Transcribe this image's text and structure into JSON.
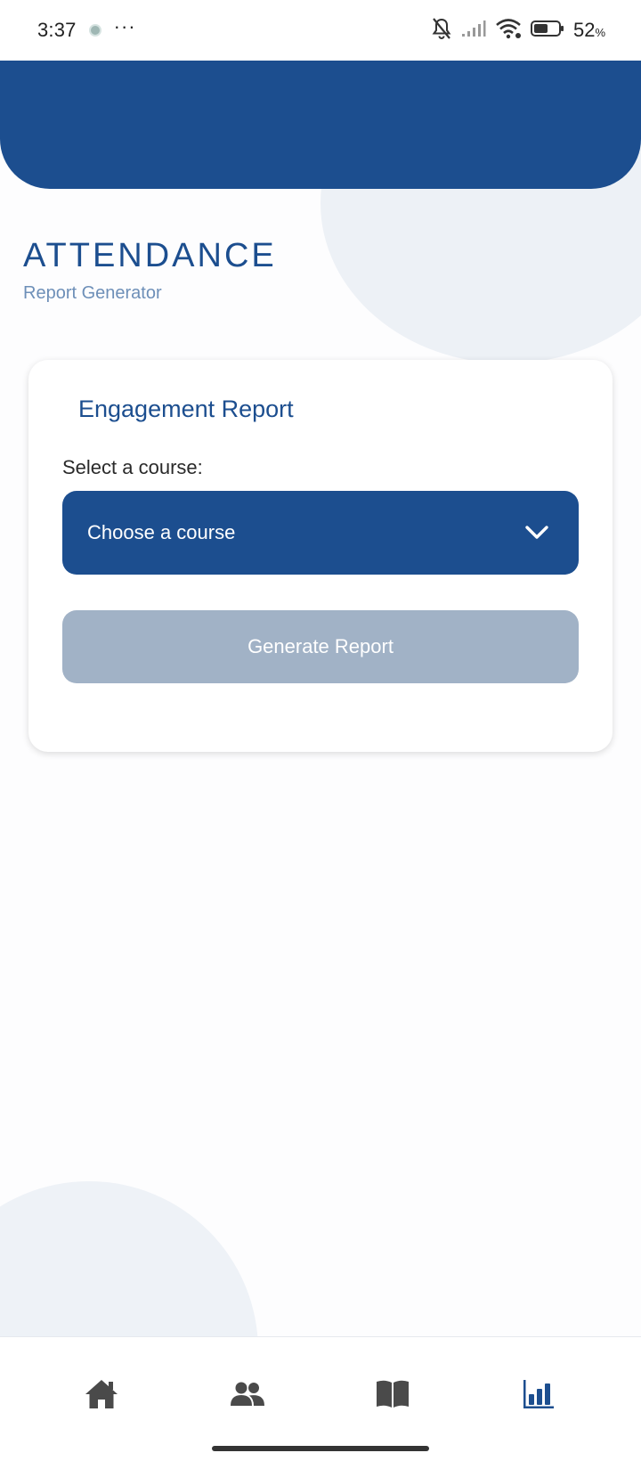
{
  "status_bar": {
    "time": "3:37",
    "more": "···",
    "battery_percent": "52",
    "battery_unit": "%",
    "icons": [
      "app-notification-icon",
      "bell-off-icon",
      "signal-icon",
      "wifi-icon",
      "battery-icon"
    ]
  },
  "header": {
    "title": "ATTENDANCE",
    "subtitle": "Report Generator"
  },
  "card": {
    "title": "Engagement Report",
    "select_label": "Select a course:",
    "select_value": "Choose a course",
    "generate_label": "Generate Report"
  },
  "bottom_nav": {
    "items": [
      {
        "icon": "home-icon",
        "active": false
      },
      {
        "icon": "people-icon",
        "active": false
      },
      {
        "icon": "book-icon",
        "active": false
      },
      {
        "icon": "bar-chart-icon",
        "active": true
      }
    ]
  },
  "colors": {
    "primary": "#1c4e8f",
    "disabled_button": "#a1b2c6",
    "nav_inactive": "#4a4a4a",
    "subtitle": "#6d8fb8"
  }
}
